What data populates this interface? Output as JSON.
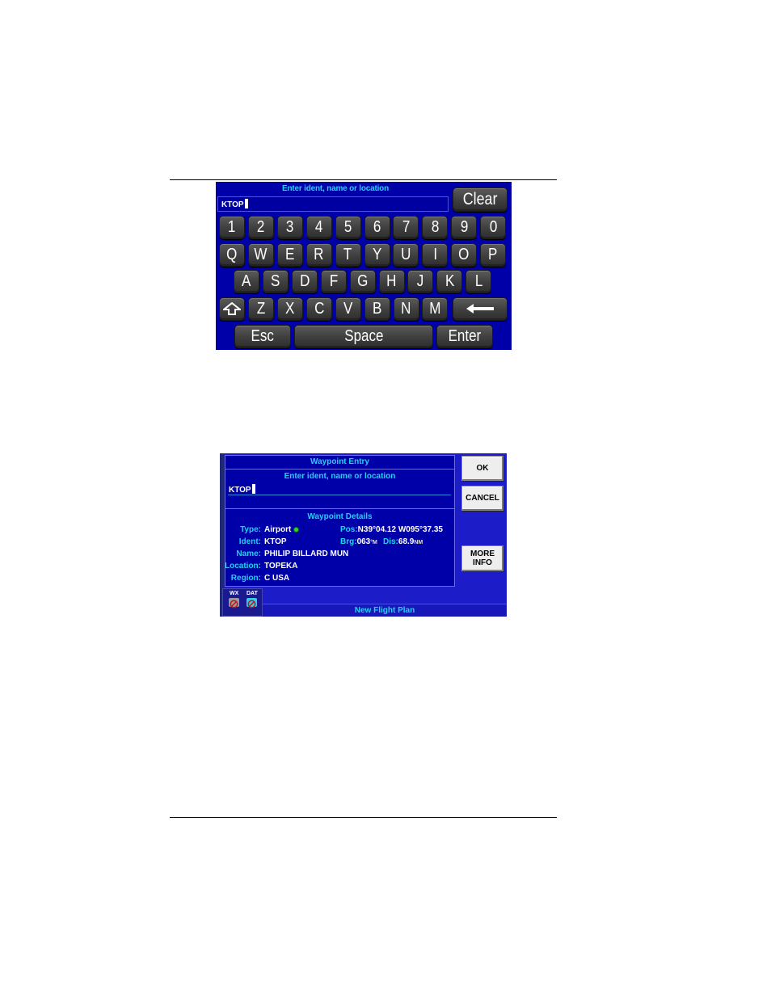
{
  "keyboard_screen": {
    "prompt": "Enter ident, name or location",
    "input_value": "KTOP",
    "clear_label": "Clear",
    "rows": [
      [
        "1",
        "2",
        "3",
        "4",
        "5",
        "6",
        "7",
        "8",
        "9",
        "0"
      ],
      [
        "Q",
        "W",
        "E",
        "R",
        "T",
        "Y",
        "U",
        "I",
        "O",
        "P"
      ],
      [
        "A",
        "S",
        "D",
        "F",
        "G",
        "H",
        "J",
        "K",
        "L"
      ],
      [
        "Z",
        "X",
        "C",
        "V",
        "B",
        "N",
        "M"
      ]
    ],
    "shift_icon": "shift-up-arrow-icon",
    "backspace_icon": "left-arrow-icon",
    "esc_label": "Esc",
    "space_label": "Space",
    "enter_label": "Enter",
    "colors": {
      "background": "#0000a8",
      "prompt": "#1ed3f0",
      "key": "#3e3e3e"
    }
  },
  "waypoint_screen": {
    "title": "Waypoint Entry",
    "prompt": "Enter ident, name or location",
    "input_value": "KTOP",
    "details_title": "Waypoint Details",
    "details": {
      "type_label": "Type:",
      "type_value": "Airport",
      "ident_label": "Ident:",
      "ident_value": "KTOP",
      "name_label": "Name:",
      "name_value": "PHILIP BILLARD MUN",
      "location_label": "Location:",
      "location_value": "TOPEKA",
      "region_label": "Region:",
      "region_value": "C USA",
      "pos_label": "Pos:",
      "pos_value": "N39°04.12 W095°37.35",
      "brg_label": "Brg:",
      "brg_value": "063",
      "brg_unit": "°M",
      "dis_label": "Dis:",
      "dis_value": "68.9",
      "dis_unit": "NM"
    },
    "buttons": {
      "ok": "OK",
      "cancel": "CANCEL",
      "more_info_line1": "MORE",
      "more_info_line2": "INFO"
    },
    "status": {
      "wx_label": "WX",
      "dat_label": "DAT"
    },
    "footer": "New Flight Plan",
    "colors": {
      "panel": "#0000a8",
      "label": "#1ed3f0",
      "value": "#ffffff",
      "status_ok": "#28d828"
    }
  }
}
